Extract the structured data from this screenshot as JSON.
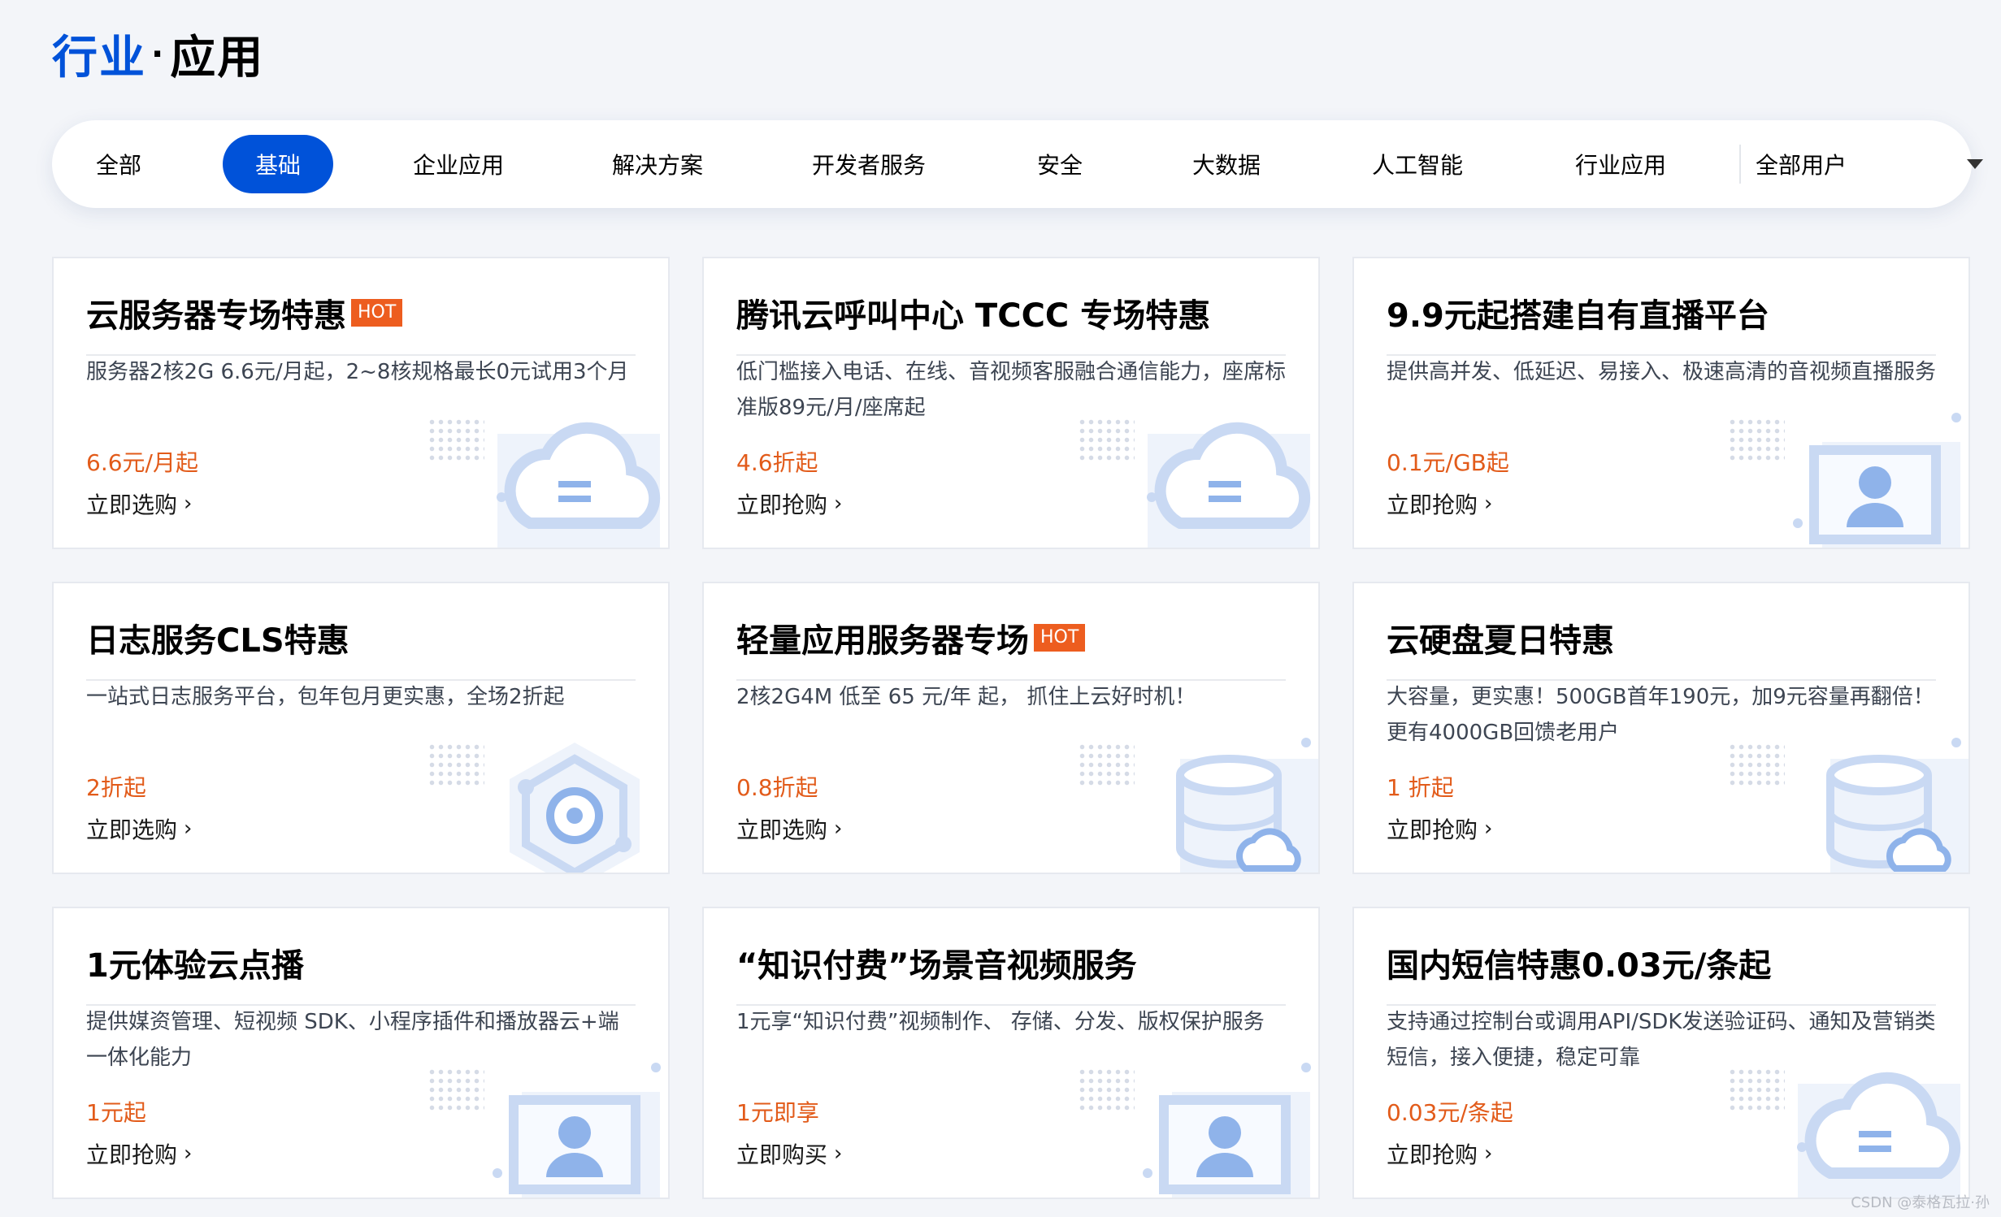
{
  "page_title": {
    "accent": "行业",
    "dot": "·",
    "rest": "应用"
  },
  "tabs": [
    {
      "label": "全部"
    },
    {
      "label": "基础",
      "active": true
    },
    {
      "label": "企业应用"
    },
    {
      "label": "解决方案"
    },
    {
      "label": "开发者服务"
    },
    {
      "label": "安全"
    },
    {
      "label": "大数据"
    },
    {
      "label": "人工智能"
    },
    {
      "label": "行业应用"
    }
  ],
  "user_filter": {
    "selected": "全部用户"
  },
  "cards": [
    {
      "title": "云服务器专场特惠",
      "badge": "HOT",
      "desc": "服务器2核2G 6.6元/月起，2~8核规格最长0元试用3个月",
      "price": "6.6元/月起",
      "cta": "立即选购",
      "icon": "cloud-icon"
    },
    {
      "title": "腾讯云呼叫中心 TCCC 专场特惠",
      "badge": "",
      "desc": "低门槛接入电话、在线、音视频客服融合通信能力，座席标准版89元/月/座席起",
      "price": "4.6折起",
      "cta": "立即抢购",
      "icon": "cloud-icon"
    },
    {
      "title": "9.9元起搭建自有直播平台",
      "badge": "",
      "desc": "提供高并发、低延迟、易接入、极速高清的音视频直播服务",
      "price": "0.1元/GB起",
      "cta": "立即抢购",
      "icon": "video-profile-icon"
    },
    {
      "title": "日志服务CLS特惠",
      "badge": "",
      "desc": "一站式日志服务平台，包年包月更实惠，全场2折起",
      "price": "2折起",
      "cta": "立即选购",
      "icon": "hexagon-network-icon"
    },
    {
      "title": "轻量应用服务器专场",
      "badge": "HOT",
      "desc": "2核2G4M 低至 65 元/年 起， 抓住上云好时机！",
      "price": "0.8折起",
      "cta": "立即选购",
      "icon": "database-cloud-icon"
    },
    {
      "title": "云硬盘夏日特惠",
      "badge": "",
      "desc": "大容量，更实惠！500GB首年190元，加9元容量再翻倍！更有4000GB回馈老用户",
      "price": "1 折起",
      "cta": "立即抢购",
      "icon": "database-cloud-icon"
    },
    {
      "title": "1元体验云点播",
      "badge": "",
      "desc": "提供媒资管理、短视频 SDK、小程序插件和播放器云+端一体化能力",
      "price": "1元起",
      "cta": "立即抢购",
      "icon": "video-profile-icon"
    },
    {
      "title": "“知识付费”场景音视频服务",
      "badge": "",
      "desc": "1元享“知识付费”视频制作、 存储、分发、版权保护服务",
      "price": "1元即享",
      "cta": "立即购买",
      "icon": "video-profile-icon"
    },
    {
      "title": "国内短信特惠0.03元/条起",
      "badge": "",
      "desc": "支持通过控制台或调用API/SDK发送验证码、通知及营销类短信，接入便捷，稳定可靠",
      "price": "0.03元/条起",
      "cta": "立即抢购",
      "icon": "cloud-icon"
    }
  ],
  "watermark": "CSDN @泰格瓦拉·孙",
  "colors": {
    "accent": "#0052d9",
    "price": "#e25b1a",
    "hot_badge": "#ed5d1f",
    "background": "#f3f5f9"
  }
}
